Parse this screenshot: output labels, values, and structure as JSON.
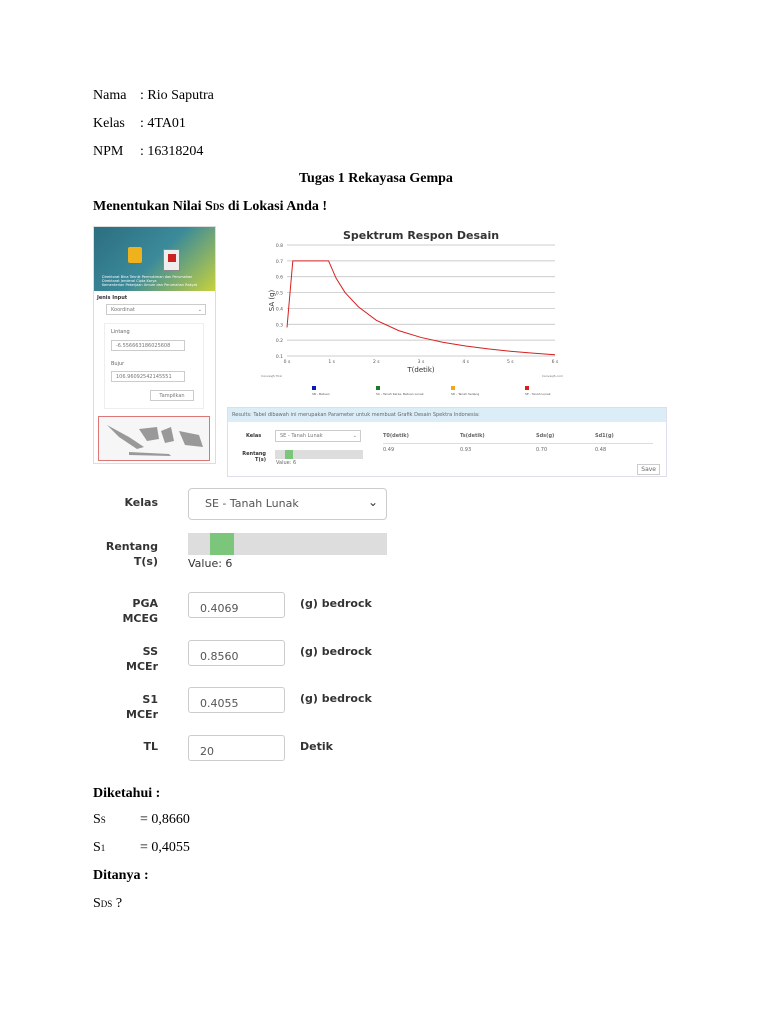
{
  "header": {
    "nama_label": "Nama",
    "nama_value": ": Rio Saputra",
    "kelas_label": "Kelas",
    "kelas_value": ": 4TA01",
    "npm_label": "NPM",
    "npm_value": ": 16318204"
  },
  "title": "Tugas 1 Rekayasa Gempa",
  "subtitle_pre": "Menentukan Nilai S",
  "subtitle_sub": "DS",
  "subtitle_post": " di Lokasi Anda !",
  "left_panel": {
    "banner_lines": [
      "Direktorat Bina Teknik Permukiman dan Perumahan",
      "Direktorat Jenderal Cipta Karya",
      "Kementerian Pekerjaan Umum dan Perumahan Rakyat"
    ],
    "jenis_input_label": "Jenis Input",
    "jenis_input_value": "Koordinat",
    "lintang_label": "Lintang",
    "lintang_value": "-6.556663186025608",
    "bujur_label": "Bujur",
    "bujur_value": "106.96092542145551",
    "button": "Tampilkan"
  },
  "chart_data": {
    "type": "line",
    "title": "Spektrum Respon Desain",
    "xlabel": "T(detik)",
    "ylabel": "SA (g)",
    "xlim": [
      0,
      6
    ],
    "ylim": [
      0.1,
      0.8
    ],
    "x_ticks": [
      "0 s",
      "1 s",
      "2 s",
      "3 s",
      "4 s",
      "5 s",
      "6 s"
    ],
    "y_ticks": [
      "0.1",
      "0.2",
      "0.3",
      "0.4",
      "0.5",
      "0.6",
      "0.7",
      "0.8"
    ],
    "series": [
      {
        "name": "SE - Tanah Lunak",
        "color": "#d62020",
        "x": [
          0,
          0.13,
          0.93,
          1.1,
          1.3,
          1.6,
          2,
          2.5,
          3,
          3.5,
          4,
          4.5,
          5,
          5.5,
          6
        ],
        "y": [
          0.28,
          0.7,
          0.7,
          0.59,
          0.5,
          0.41,
          0.325,
          0.26,
          0.217,
          0.186,
          0.163,
          0.145,
          0.13,
          0.118,
          0.108
        ]
      }
    ],
    "legend": [
      {
        "label": "SB - Batuan",
        "color": "#0a1ab8"
      },
      {
        "label": "SC - Tanah Keras, Batuan Lunak",
        "color": "#1a7a2a"
      },
      {
        "label": "SD - Tanah Sedang",
        "color": "#f0a818"
      },
      {
        "label": "SE - Tanah Lunak",
        "color": "#d62020"
      }
    ],
    "footer_left": "CanvasJS Trial",
    "footer_right": "CanvasJS.com"
  },
  "results": {
    "header": "Results: Tabel dibawah ini merupakan Parameter untuk membuat Grafik Desain Spektra Indonesia:",
    "kelas_label": "Kelas",
    "kelas_value": "SE - Tanah Lunak",
    "rentang_label": "Rentang T(s)",
    "value_label": "Value: 6",
    "columns": [
      "T0(detik)",
      "Ts(detik)",
      "Sds(g)",
      "Sd1(g)"
    ],
    "values": [
      "0.49",
      "0.93",
      "0.70",
      "0.48"
    ],
    "save": "Save"
  },
  "form": {
    "kelas_label": "Kelas",
    "kelas_value": "SE - Tanah Lunak",
    "rentang_label_1": "Rentang",
    "rentang_label_2": "T(s)",
    "slider_value_label": "Value: 6",
    "slider_fraction": 0.2,
    "fields": [
      {
        "label1": "PGA",
        "label2": "MCEG",
        "value": "0.4069",
        "unit": "(g) bedrock"
      },
      {
        "label1": "SS",
        "label2": "MCEr",
        "value": "0.8560",
        "unit": "(g) bedrock"
      },
      {
        "label1": "S1",
        "label2": "MCEr",
        "value": "0.4055",
        "unit": "(g) bedrock"
      },
      {
        "label1": "TL",
        "label2": "",
        "value": "20",
        "unit": "Detik"
      }
    ]
  },
  "diketahui": {
    "heading": "Diketahui :",
    "ss_main": "S",
    "ss_sub": "S",
    "ss_value": "= 0,8660",
    "s1_main": "S",
    "s1_sub": "1",
    "s1_value": "= 0,4055"
  },
  "ditanya": {
    "heading": "Ditanya :",
    "main": "S",
    "sub": "DS",
    "suffix": " ?"
  }
}
